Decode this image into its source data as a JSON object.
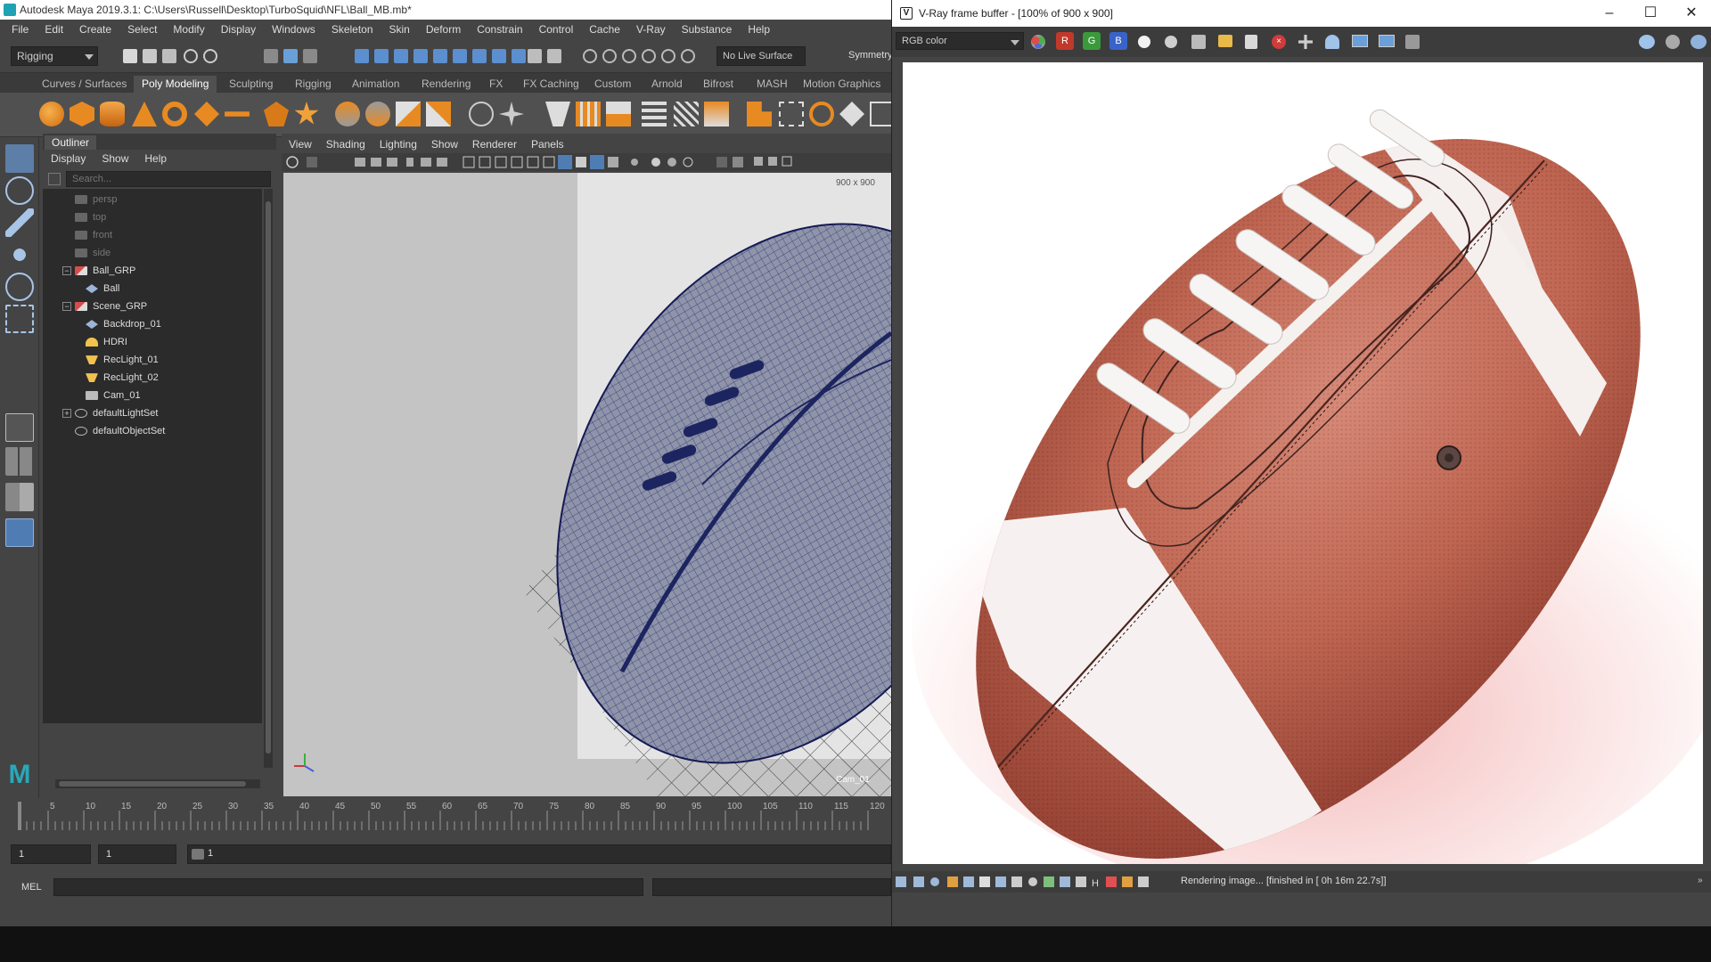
{
  "maya": {
    "title": "Autodesk Maya 2019.3.1: C:\\Users\\Russell\\Desktop\\TurboSquid\\NFL\\Ball_MB.mb*",
    "menu": [
      "File",
      "Edit",
      "Create",
      "Select",
      "Modify",
      "Display",
      "Windows",
      "Skeleton",
      "Skin",
      "Deform",
      "Constrain",
      "Control",
      "Cache",
      "V-Ray",
      "Substance",
      "Help"
    ],
    "menuset": "Rigging",
    "live_surface": "No Live Surface",
    "symmetry": "Symmetry",
    "shelf_tabs": [
      "Curves / Surfaces",
      "Poly Modeling",
      "Sculpting",
      "Rigging",
      "Animation",
      "Rendering",
      "FX",
      "FX Caching",
      "Custom",
      "Arnold",
      "Bifrost",
      "MASH",
      "Motion Graphics"
    ],
    "active_shelf": "Poly Modeling"
  },
  "outliner": {
    "tab": "Outliner",
    "menu": [
      "Display",
      "Show",
      "Help"
    ],
    "search_placeholder": "Search...",
    "items": [
      "persp",
      "top",
      "front",
      "side",
      "Ball_GRP",
      "Ball",
      "Scene_GRP",
      "Backdrop_01",
      "HDRI",
      "RecLight_01",
      "RecLight_02",
      "Cam_01",
      "defaultLightSet",
      "defaultObjectSet"
    ]
  },
  "viewport": {
    "menu": [
      "View",
      "Shading",
      "Lighting",
      "Show",
      "Renderer",
      "Panels"
    ],
    "resolution": "900 x 900",
    "camera": "Cam_01"
  },
  "timeline": {
    "ticks": [
      "5",
      "10",
      "15",
      "20",
      "25",
      "30",
      "35",
      "40",
      "45",
      "50",
      "55",
      "60",
      "65",
      "70",
      "75",
      "80",
      "85",
      "90",
      "95",
      "100",
      "105",
      "110",
      "115",
      "120"
    ],
    "current": "1",
    "start": "1",
    "range_start": "1",
    "range_label": "1"
  },
  "command": {
    "label": "MEL"
  },
  "vray": {
    "title": "V-Ray frame buffer - [100% of 900 x 900]",
    "channel": "RGB color",
    "status": "Rendering image... [finished in [ 0h 16m 22.7s]]",
    "rgb_buttons": [
      "R",
      "G",
      "B"
    ],
    "colors": {
      "r": "#c0392b",
      "g": "#3a9a3a",
      "b": "#3a63c9"
    }
  }
}
